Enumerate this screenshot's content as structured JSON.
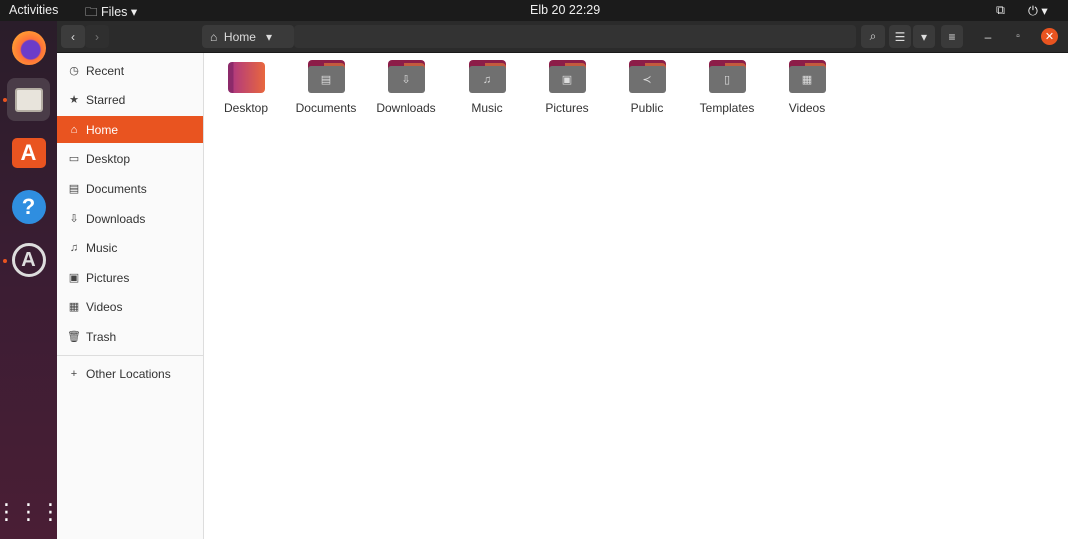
{
  "topbar": {
    "activities": "Activities",
    "app_menu": "Files",
    "clock": "Elb 20  22:29"
  },
  "header": {
    "location": "Home"
  },
  "sidebar": {
    "items": [
      {
        "label": "Recent",
        "icon": "clock-icon"
      },
      {
        "label": "Starred",
        "icon": "star-icon"
      },
      {
        "label": "Home",
        "icon": "home-icon",
        "active": true
      },
      {
        "label": "Desktop",
        "icon": "desktop-icon"
      },
      {
        "label": "Documents",
        "icon": "document-icon"
      },
      {
        "label": "Downloads",
        "icon": "download-icon"
      },
      {
        "label": "Music",
        "icon": "music-icon"
      },
      {
        "label": "Pictures",
        "icon": "picture-icon"
      },
      {
        "label": "Videos",
        "icon": "video-icon"
      },
      {
        "label": "Trash",
        "icon": "trash-icon"
      }
    ],
    "other_locations": "Other Locations"
  },
  "files": [
    {
      "label": "Desktop"
    },
    {
      "label": "Documents"
    },
    {
      "label": "Downloads"
    },
    {
      "label": "Music"
    },
    {
      "label": "Pictures"
    },
    {
      "label": "Public"
    },
    {
      "label": "Templates"
    },
    {
      "label": "Videos"
    }
  ],
  "colors": {
    "accent": "#e95420",
    "folder_top": "#8c1d48"
  }
}
